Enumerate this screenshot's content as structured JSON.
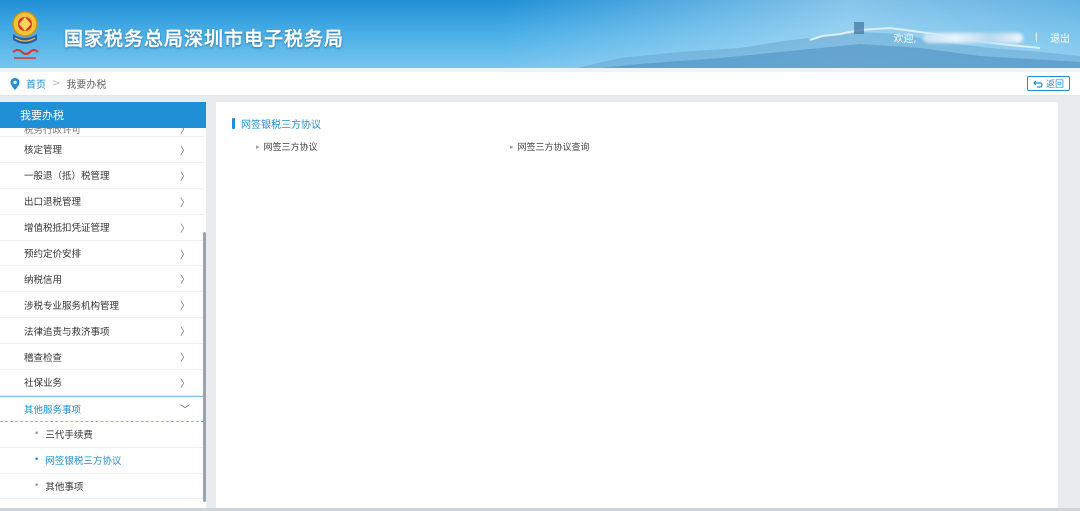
{
  "header": {
    "title": "国家税务总局深圳市电子税务局",
    "welcome": "欢迎,",
    "separator": "|",
    "logout": "退出"
  },
  "breadcrumb": {
    "home": "首页",
    "arrow": ">",
    "current": "我要办税",
    "back_label": "返回"
  },
  "sidebar": {
    "header": "我要办税",
    "cut_item": "税务行政许可",
    "items": [
      {
        "label": "核定管理"
      },
      {
        "label": "一般退（抵）税管理"
      },
      {
        "label": "出口退税管理"
      },
      {
        "label": "增值税抵扣凭证管理"
      },
      {
        "label": "预约定价安排"
      },
      {
        "label": "纳税信用"
      },
      {
        "label": "涉税专业服务机构管理"
      },
      {
        "label": "法律追责与救济事项"
      },
      {
        "label": "稽查检查"
      },
      {
        "label": "社保业务"
      }
    ],
    "open_item": "其他服务事项",
    "sub_items": [
      {
        "label": "三代手续费"
      },
      {
        "label": "网签银税三方协议"
      },
      {
        "label": "其他事项"
      }
    ]
  },
  "main": {
    "section_title": "网签银税三方协议",
    "links": [
      {
        "label": "网签三方协议"
      },
      {
        "label": "网签三方协议查询"
      }
    ]
  },
  "colors": {
    "accent": "#1f8fd6",
    "header_bg": "#48aee6"
  }
}
